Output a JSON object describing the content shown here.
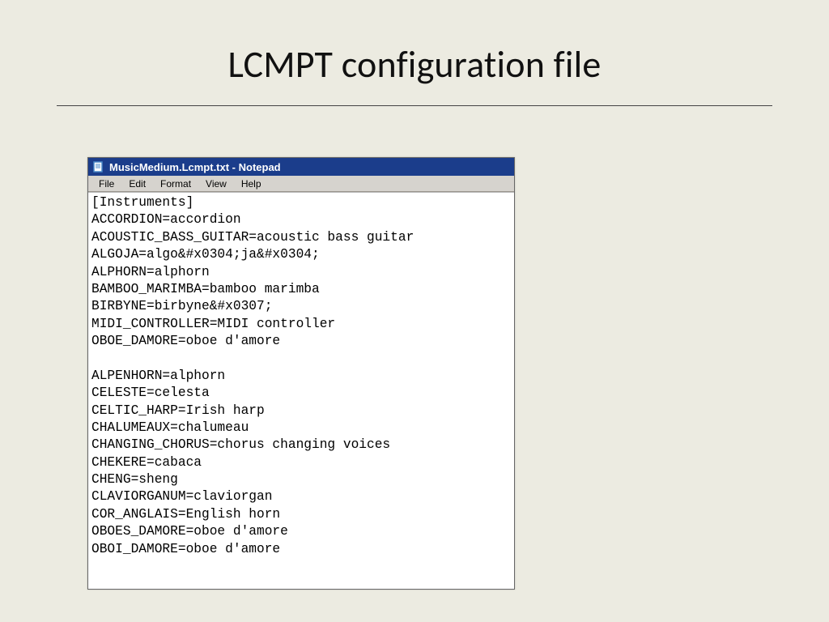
{
  "slide": {
    "title": "LCMPT configuration file"
  },
  "notepad": {
    "titlebar": "MusicMedium.Lcmpt.txt - Notepad",
    "menus": {
      "file": "File",
      "edit": "Edit",
      "format": "Format",
      "view": "View",
      "help": "Help"
    },
    "content": "[Instruments]\nACCORDION=accordion\nACOUSTIC_BASS_GUITAR=acoustic bass guitar\nALGOJA=algo&#x0304;ja&#x0304;\nALPHORN=alphorn\nBAMBOO_MARIMBA=bamboo marimba\nBIRBYNE=birbyne&#x0307;\nMIDI_CONTROLLER=MIDI controller\nOBOE_DAMORE=oboe d'amore\n\nALPENHORN=alphorn\nCELESTE=celesta\nCELTIC_HARP=Irish harp\nCHALUMEAUX=chalumeau\nCHANGING_CHORUS=chorus changing voices\nCHEKERE=cabaca\nCHENG=sheng\nCLAVIORGANUM=claviorgan\nCOR_ANGLAIS=English horn\nOBOES_DAMORE=oboe d'amore\nOBOI_DAMORE=oboe d'amore"
  }
}
